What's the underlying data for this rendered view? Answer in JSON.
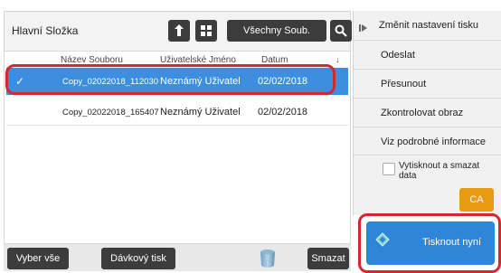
{
  "header": {
    "folder_title": "Hlavní Složka",
    "filter_button": "Všechny Soub."
  },
  "columns": {
    "name": "Název Souboru",
    "user": "Uživatelské Jméno",
    "date": "Datum",
    "sort_indicator": "↓"
  },
  "files": [
    {
      "check": "✓",
      "name": "Copy_02022018_112030",
      "user": "Neznámý Uživatel",
      "date": "02/02/2018",
      "selected": true
    },
    {
      "check": "",
      "name": "Copy_02022018_165407",
      "user": "Neznámý Uživatel",
      "date": "02/02/2018",
      "selected": false
    }
  ],
  "bottom_bar": {
    "select_all": "Vyber vše",
    "batch_print": "Dávkový tisk",
    "delete": "Smazat"
  },
  "right_menu": {
    "items": [
      "Změnit nastavení tisku",
      "Odeslat",
      "Přesunout",
      "Zkontrolovat obraz",
      "Viz podrobné informace"
    ],
    "print_and_delete_label": "Vytisknout a smazat data",
    "ca_button": "CA",
    "print_now_button": "Tisknout nyní"
  },
  "icons": {
    "up": "up-arrow-icon",
    "grid": "grid-icon",
    "search": "search-icon",
    "trash": "trash-icon",
    "expand": "expand-arrow-icon",
    "print": "start-diamond-icon"
  },
  "colors": {
    "selected_row": "#3d8ede",
    "highlight_outline": "#d62631",
    "dark_button": "#3c3c3c",
    "ca_button": "#e99a13",
    "print_button": "#2f86d8"
  }
}
